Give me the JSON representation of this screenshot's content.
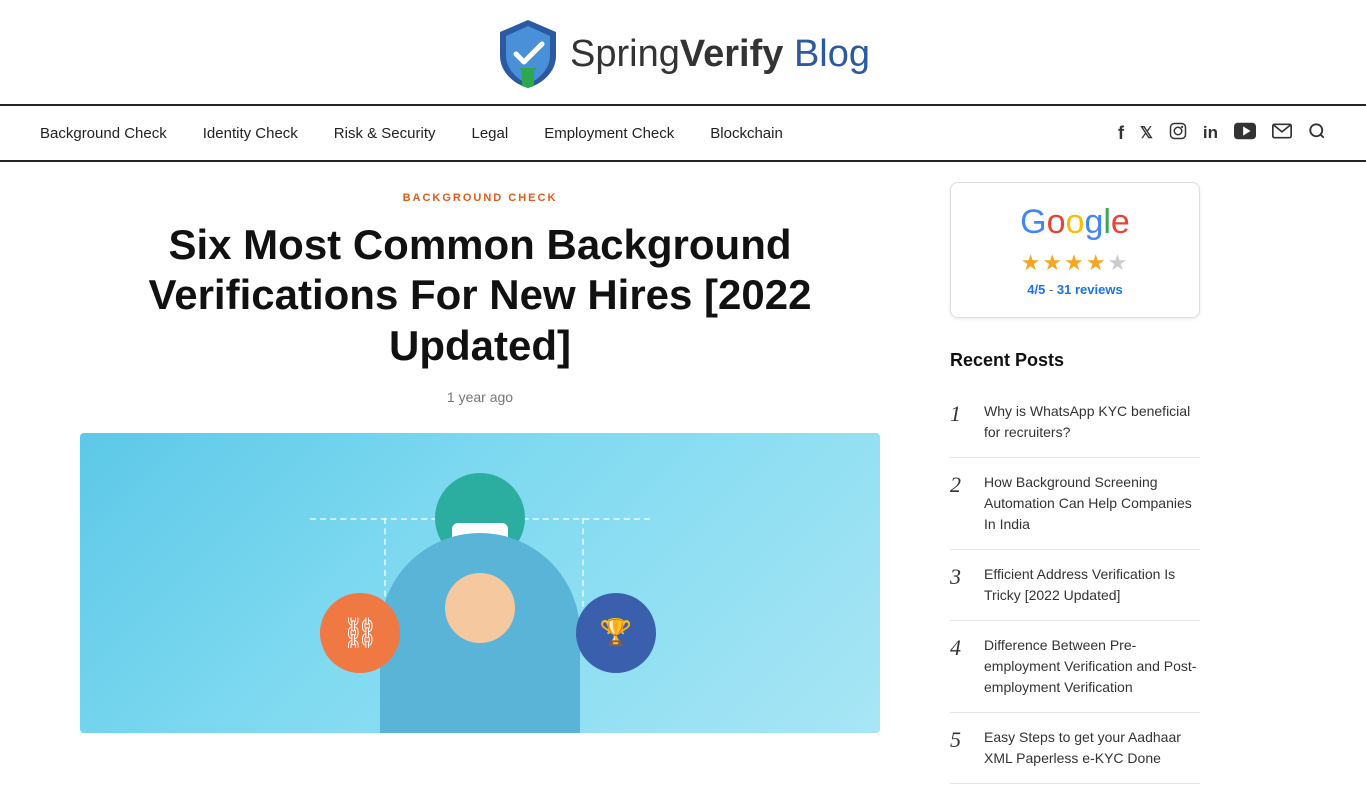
{
  "header": {
    "logo_text_spring": "Spring",
    "logo_text_verify": "Verify",
    "logo_text_blog": "Blog"
  },
  "nav": {
    "links": [
      {
        "id": "background-check",
        "label": "Background Check"
      },
      {
        "id": "identity-check",
        "label": "Identity Check"
      },
      {
        "id": "risk-security",
        "label": "Risk & Security"
      },
      {
        "id": "legal",
        "label": "Legal"
      },
      {
        "id": "employment-check",
        "label": "Employment Check"
      },
      {
        "id": "blockchain",
        "label": "Blockchain"
      }
    ],
    "icons": [
      "f",
      "𝕏",
      "📷",
      "in",
      "▶",
      "✉",
      "🔍"
    ]
  },
  "article": {
    "category": "BACKGROUND CHECK",
    "title": "Six Most Common Background Verifications For New Hires [2022 Updated]",
    "meta": "1 year ago"
  },
  "sidebar": {
    "google_label": "Google",
    "rating_text": "4/5",
    "review_count": "31 reviews",
    "recent_posts_title": "Recent Posts",
    "posts": [
      {
        "number": "1",
        "text": "Why is WhatsApp KYC beneficial for recruiters?"
      },
      {
        "number": "2",
        "text": "How Background Screening Automation Can Help Companies In India"
      },
      {
        "number": "3",
        "text": "Efficient Address Verification Is Tricky [2022 Updated]"
      },
      {
        "number": "4",
        "text": "Difference Between Pre-employment Verification and Post-employment Verification"
      },
      {
        "number": "5",
        "text": "Easy Steps to get your Aadhaar XML Paperless e-KYC Done"
      }
    ]
  }
}
